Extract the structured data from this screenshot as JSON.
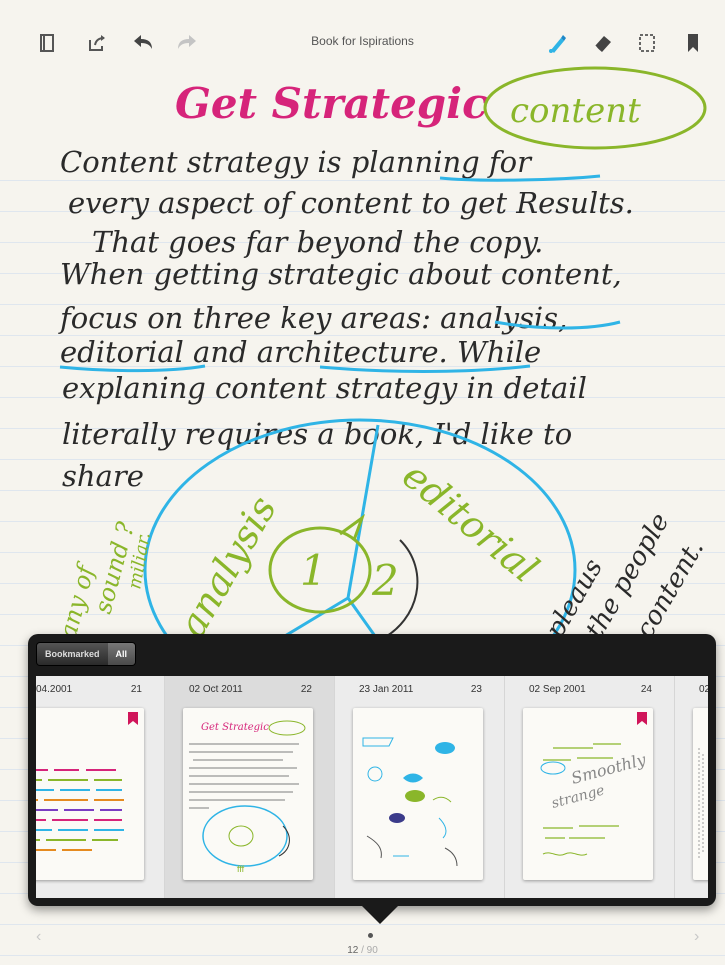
{
  "toolbar": {
    "title": "Book for Ispirations",
    "left_icons": [
      "pages-icon",
      "share-icon",
      "undo-icon",
      "redo-icon"
    ],
    "right_icons": [
      "pen-icon",
      "eraser-icon",
      "selection-icon",
      "bookmark-icon"
    ]
  },
  "note": {
    "heading": "Get Strategic",
    "heading_circled": "content",
    "lines": [
      "Content strategy is planning for",
      "every aspect of content to get Results.",
      "That goes far beyond the copy.",
      "When getting strategic about content,",
      "focus on three key areas: analysis,",
      "editorial and architecture. While",
      "explaning content strategy in detail",
      "literally requires a book, I'd like to",
      "share"
    ],
    "diagram": {
      "labels": [
        "analysis",
        "editorial",
        "1",
        "2"
      ],
      "side_left": [
        "any of",
        "sound ?",
        "miliar."
      ],
      "side_right": [
        "pleaus",
        "the people",
        "content."
      ]
    }
  },
  "popover": {
    "segments": [
      "Bookmarked",
      "All"
    ],
    "active_segment": "All",
    "pages": [
      {
        "date": "04.2001",
        "num": "21",
        "bookmarked": true
      },
      {
        "date": "02 Oct 2011",
        "num": "22",
        "bookmarked": false,
        "selected": true
      },
      {
        "date": "23 Jan 2011",
        "num": "23",
        "bookmarked": false
      },
      {
        "date": "02 Sep 2001",
        "num": "24",
        "bookmarked": true
      },
      {
        "date": "02",
        "num": "",
        "bookmarked": false
      }
    ]
  },
  "pager": {
    "current": "12",
    "total": "/ 90"
  },
  "colors": {
    "magenta": "#d6247a",
    "cyan": "#2fb4e6",
    "green": "#8ab62a",
    "bookmark_red": "#d0155a"
  }
}
